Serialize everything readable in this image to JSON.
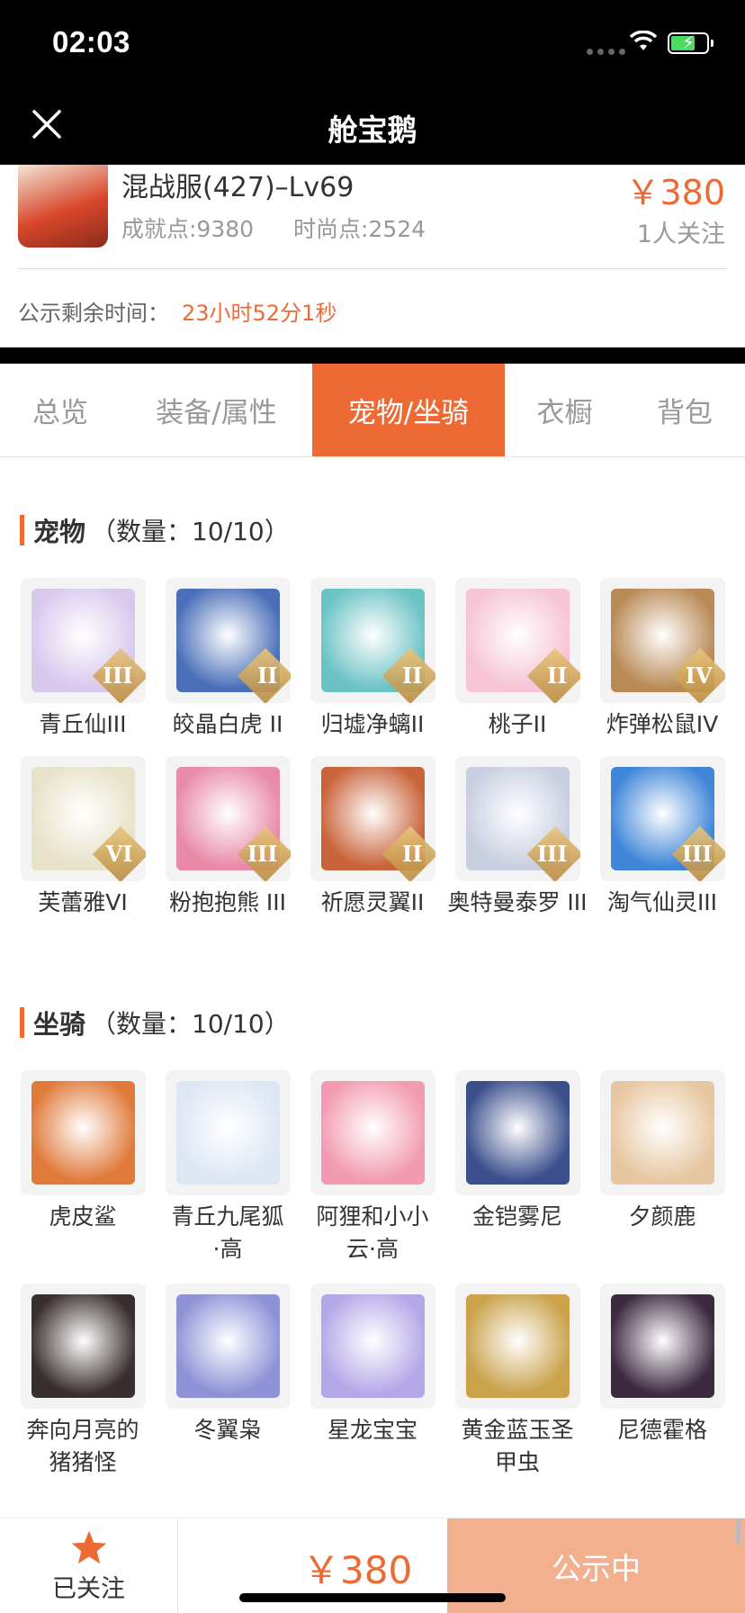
{
  "status_bar": {
    "time": "02:03"
  },
  "nav": {
    "title": "舱宝鹅"
  },
  "listing": {
    "server": "混战服(427)–Lv69",
    "price": "￥380",
    "achievement": "成就点:9380",
    "fashion": "时尚点:2524",
    "followers": "1人关注",
    "remain_label": "公示剩余时间：",
    "remain_value": "23小时52分1秒"
  },
  "tabs": [
    {
      "label": "总览",
      "active": false
    },
    {
      "label": "装备/属性",
      "active": false
    },
    {
      "label": "宠物/坐骑",
      "active": true
    },
    {
      "label": "衣橱",
      "active": false
    },
    {
      "label": "背包",
      "active": false
    }
  ],
  "pets": {
    "title": "宠物",
    "count": "（数量：10/10）",
    "items": [
      {
        "name": "青丘仙III",
        "rank": "III",
        "color": "#d9c8ee"
      },
      {
        "name": "皎晶白虎 II",
        "rank": "II",
        "color": "#4a6fb8"
      },
      {
        "name": "归墟净螭II",
        "rank": "II",
        "color": "#6cc3c5"
      },
      {
        "name": "桃子II",
        "rank": "II",
        "color": "#f6c4d4"
      },
      {
        "name": "炸弹松鼠IV",
        "rank": "IV",
        "color": "#b98a55"
      },
      {
        "name": "芙蕾雅VI",
        "rank": "VI",
        "color": "#e7e2c8"
      },
      {
        "name": "粉抱抱熊 III",
        "rank": "III",
        "color": "#e88aa8"
      },
      {
        "name": "祈愿灵翼II",
        "rank": "II",
        "color": "#c9643a"
      },
      {
        "name": "奥特曼泰罗 III",
        "rank": "III",
        "color": "#c8cfe0"
      },
      {
        "name": "淘气仙灵III",
        "rank": "III",
        "color": "#3f86d8"
      }
    ]
  },
  "mounts": {
    "title": "坐骑",
    "count": "（数量：10/10）",
    "items": [
      {
        "name": "虎皮鲨",
        "color": "#e07a3a"
      },
      {
        "name": "青丘九尾狐 ·高",
        "color": "#dde6f3"
      },
      {
        "name": "阿狸和小小 云·高",
        "color": "#f29bb0"
      },
      {
        "name": "金铠雾尼",
        "color": "#3b4f8c"
      },
      {
        "name": "夕颜鹿",
        "color": "#e7c7a1"
      },
      {
        "name": "奔向月亮的 猪猪怪",
        "color": "#3a2f2f"
      },
      {
        "name": "冬翼枭",
        "color": "#8d92d6"
      },
      {
        "name": "星龙宝宝",
        "color": "#b4a7e8"
      },
      {
        "name": "黄金蓝玉圣 甲虫",
        "color": "#c9a24a"
      },
      {
        "name": "尼德霍格",
        "color": "#3c2a3f"
      }
    ]
  },
  "bottom": {
    "follow_label": "已关注",
    "price": "￥380",
    "status": "公示中"
  },
  "colors": {
    "accent": "#ee6a35",
    "status_button": "#f2b08f"
  }
}
